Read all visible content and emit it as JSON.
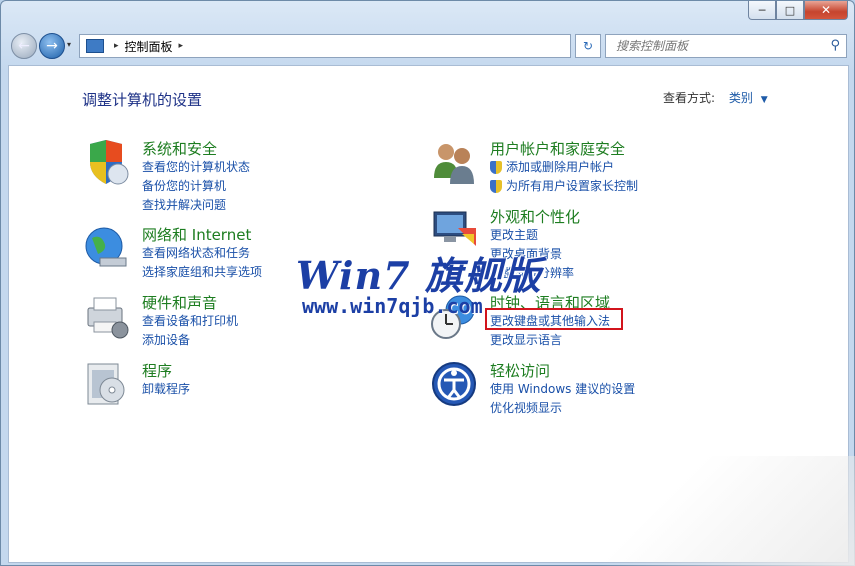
{
  "window": {
    "minimize": "─",
    "maximize": "□",
    "close": "✕"
  },
  "nav": {
    "back": "←",
    "forward": "→",
    "dropdown": "▾"
  },
  "address": {
    "sep1": "▸",
    "path": "控制面板",
    "sep2": "▸",
    "dropdown": "▾"
  },
  "refresh": "↻",
  "search": {
    "placeholder": "搜索控制面板",
    "icon": "⚲"
  },
  "page": {
    "title": "调整计算机的设置",
    "view_by_label": "查看方式:",
    "view_by_value": "类别",
    "view_by_arrow": "▼"
  },
  "categories": [
    {
      "title": "系统和安全",
      "links": [
        "查看您的计算机状态",
        "备份您的计算机",
        "查找并解决问题"
      ],
      "icon": "shield-icon"
    },
    {
      "title": "网络和 Internet",
      "links": [
        "查看网络状态和任务",
        "选择家庭组和共享选项"
      ],
      "icon": "globe-network-icon"
    },
    {
      "title": "硬件和声音",
      "links": [
        "查看设备和打印机",
        "添加设备"
      ],
      "icon": "printer-icon"
    },
    {
      "title": "程序",
      "links": [
        "卸载程序"
      ],
      "icon": "programs-icon"
    },
    {
      "title": "用户帐户和家庭安全",
      "links": [
        "添加或删除用户帐户",
        "为所有用户设置家长控制"
      ],
      "icon": "users-icon"
    },
    {
      "title": "外观和个性化",
      "links": [
        "更改主题",
        "更改桌面背景",
        "调整屏幕分辨率"
      ],
      "icon": "monitor-palette-icon"
    },
    {
      "title": "时钟、语言和区域",
      "links": [
        "更改键盘或其他输入法",
        "更改显示语言"
      ],
      "icon": "clock-globe-icon"
    },
    {
      "title": "轻松访问",
      "links": [
        "使用 Windows 建议的设置",
        "优化视频显示"
      ],
      "icon": "ease-of-access-icon"
    }
  ],
  "watermark": {
    "line1": "Win7 旗舰版",
    "line2": "www.win7qjb.com"
  },
  "colors": {
    "category_title": "#1d7d20",
    "link": "#1a50a8",
    "highlight_border": "#d2141c"
  }
}
